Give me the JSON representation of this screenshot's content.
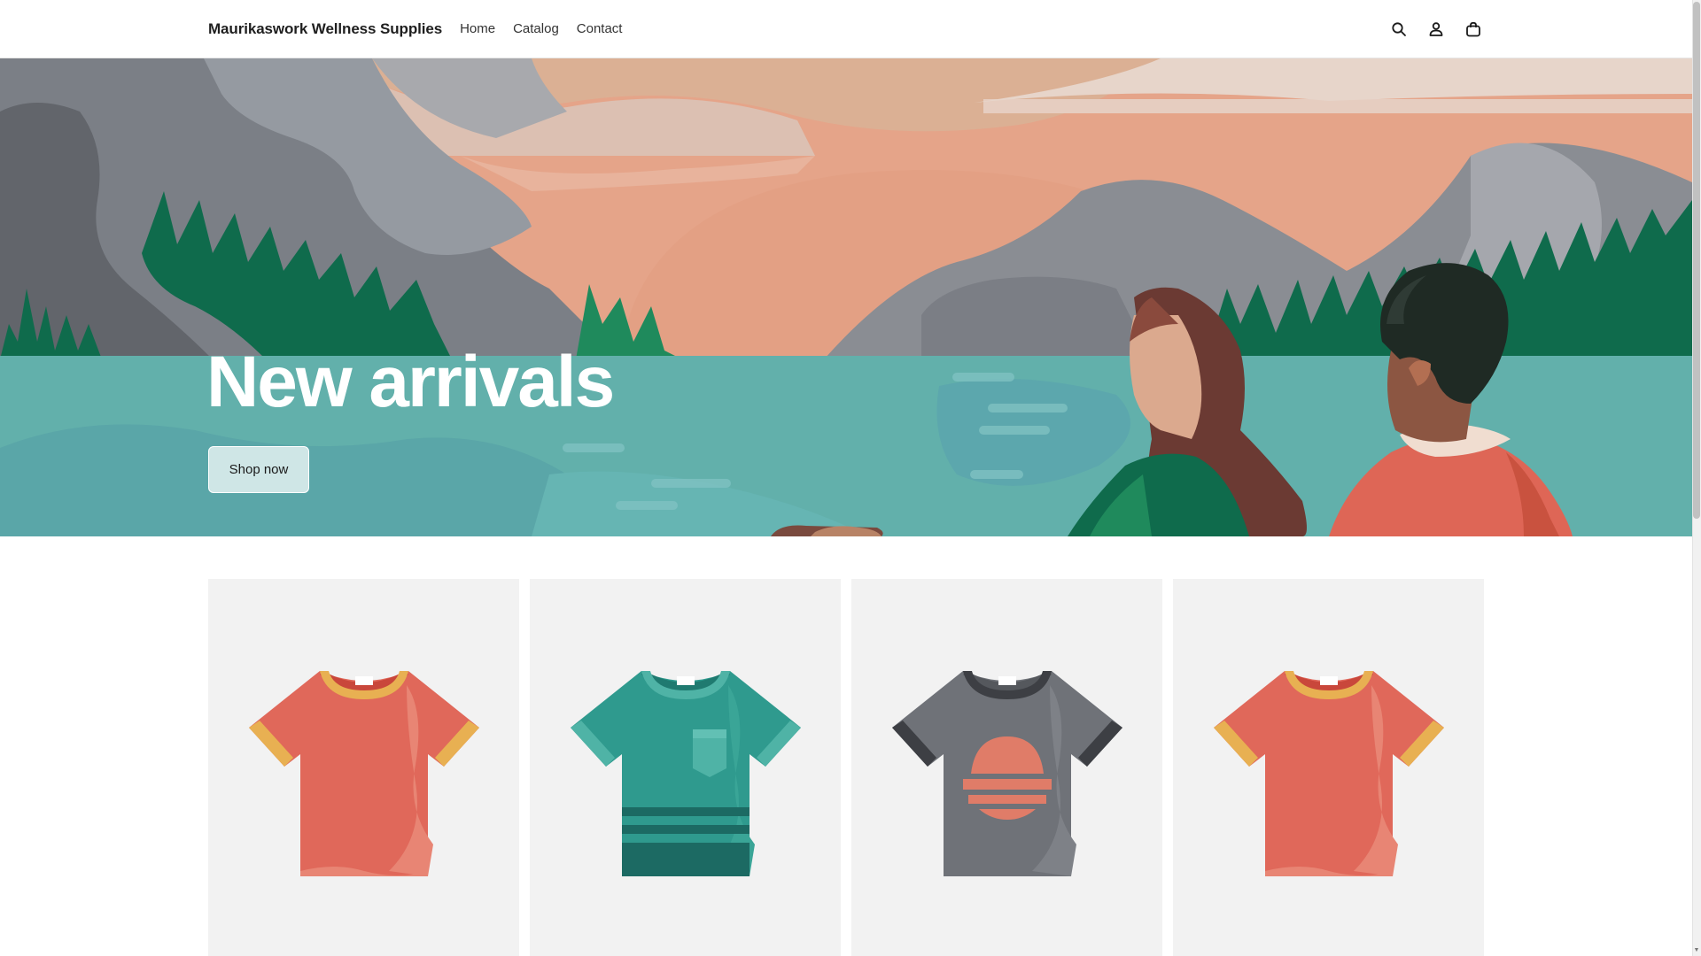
{
  "header": {
    "brand": "Maurikaswork Wellness Supplies",
    "nav": [
      {
        "label": "Home"
      },
      {
        "label": "Catalog"
      },
      {
        "label": "Contact"
      }
    ],
    "icons": [
      "search-icon",
      "account-icon",
      "cart-icon"
    ]
  },
  "hero": {
    "title": "New arrivals",
    "button_label": "Shop now"
  },
  "products": [
    {
      "shirt": "#e0685a",
      "trim": "#e8b052",
      "inner": "#c9473b"
    },
    {
      "shirt": "#2f9a8e",
      "trim": "#4fb3a6",
      "inner": "#1f7a70"
    },
    {
      "shirt": "#6f7278",
      "trim": "#3d3f44",
      "inner": "#3d3f44"
    },
    {
      "shirt": "#e0685a",
      "trim": "#e8b052",
      "inner": "#c9473b"
    }
  ],
  "colors": {
    "sky": "#e5a489",
    "water": "#62b0ab",
    "mountain": "#8a8d93",
    "trees": "#0f6b4c"
  }
}
